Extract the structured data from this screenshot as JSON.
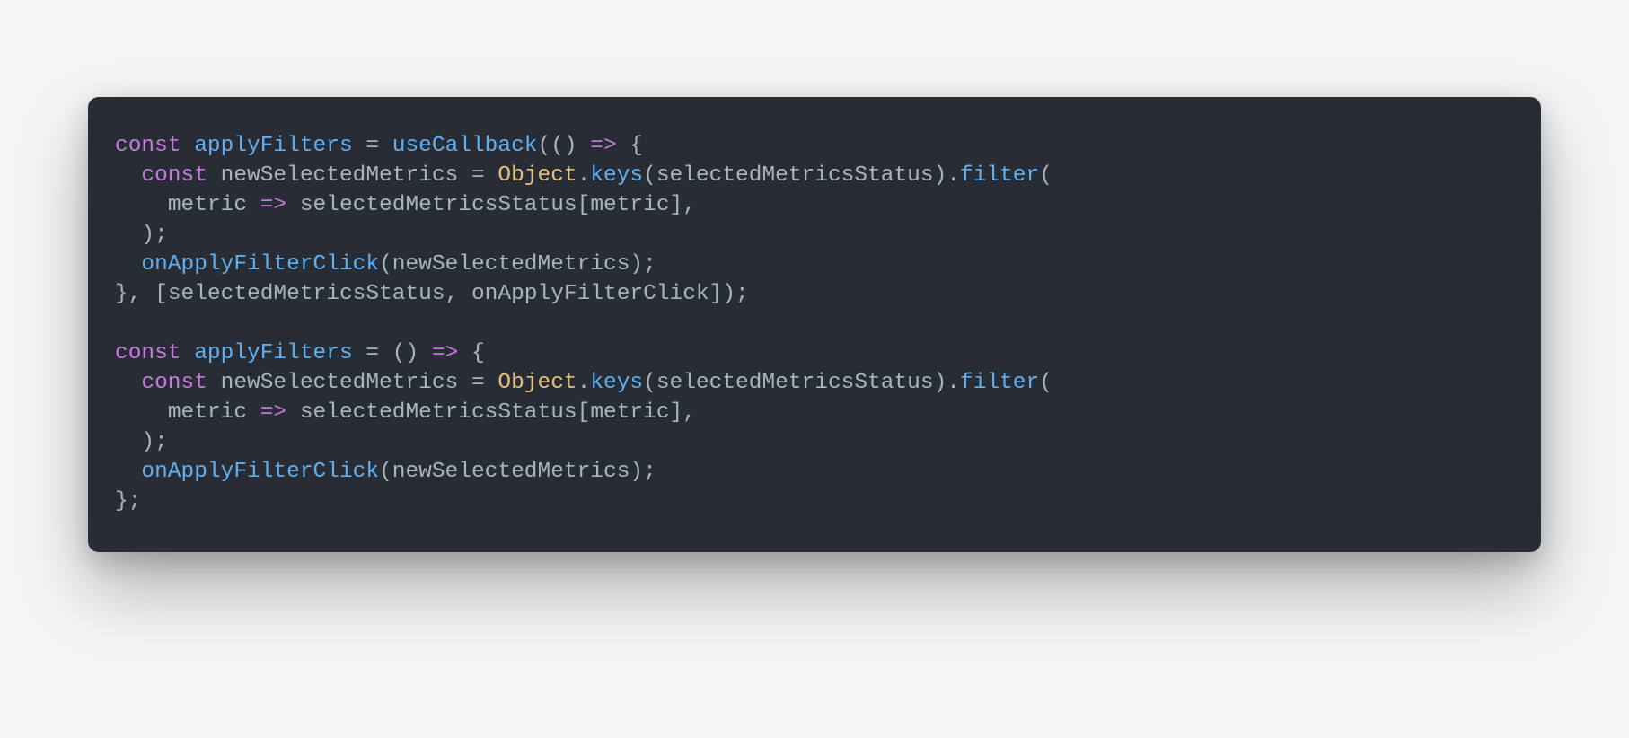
{
  "colors": {
    "bg_page": "#f5f5f5",
    "bg_card": "#282c34",
    "text_default": "#abb2bf",
    "keyword": "#c678dd",
    "function": "#61afef",
    "class": "#e5c07b"
  },
  "code": {
    "lines": [
      [
        {
          "t": "const",
          "c": "kw"
        },
        {
          "t": " ",
          "c": "sp"
        },
        {
          "t": "applyFilters",
          "c": "fn"
        },
        {
          "t": " ",
          "c": "sp"
        },
        {
          "t": "=",
          "c": "op"
        },
        {
          "t": " ",
          "c": "sp"
        },
        {
          "t": "useCallback",
          "c": "fn"
        },
        {
          "t": "(()",
          "c": "punc"
        },
        {
          "t": " ",
          "c": "sp"
        },
        {
          "t": "=>",
          "c": "arrow"
        },
        {
          "t": " ",
          "c": "sp"
        },
        {
          "t": "{",
          "c": "punc"
        }
      ],
      [
        {
          "t": "  ",
          "c": "sp"
        },
        {
          "t": "const",
          "c": "kw"
        },
        {
          "t": " ",
          "c": "sp"
        },
        {
          "t": "newSelectedMetrics",
          "c": "var"
        },
        {
          "t": " ",
          "c": "sp"
        },
        {
          "t": "=",
          "c": "op"
        },
        {
          "t": " ",
          "c": "sp"
        },
        {
          "t": "Object",
          "c": "cls"
        },
        {
          "t": ".",
          "c": "punc"
        },
        {
          "t": "keys",
          "c": "fn"
        },
        {
          "t": "(",
          "c": "punc"
        },
        {
          "t": "selectedMetricsStatus",
          "c": "var"
        },
        {
          "t": ").",
          "c": "punc"
        },
        {
          "t": "filter",
          "c": "fn"
        },
        {
          "t": "(",
          "c": "punc"
        }
      ],
      [
        {
          "t": "    ",
          "c": "sp"
        },
        {
          "t": "metric",
          "c": "var"
        },
        {
          "t": " ",
          "c": "sp"
        },
        {
          "t": "=>",
          "c": "arrow"
        },
        {
          "t": " ",
          "c": "sp"
        },
        {
          "t": "selectedMetricsStatus",
          "c": "var"
        },
        {
          "t": "[",
          "c": "punc"
        },
        {
          "t": "metric",
          "c": "var"
        },
        {
          "t": "],",
          "c": "punc"
        }
      ],
      [
        {
          "t": "  );",
          "c": "punc"
        }
      ],
      [
        {
          "t": "  ",
          "c": "sp"
        },
        {
          "t": "onApplyFilterClick",
          "c": "fn"
        },
        {
          "t": "(",
          "c": "punc"
        },
        {
          "t": "newSelectedMetrics",
          "c": "var"
        },
        {
          "t": ");",
          "c": "punc"
        }
      ],
      [
        {
          "t": "}, [",
          "c": "punc"
        },
        {
          "t": "selectedMetricsStatus",
          "c": "var"
        },
        {
          "t": ", ",
          "c": "punc"
        },
        {
          "t": "onApplyFilterClick",
          "c": "var"
        },
        {
          "t": "]);",
          "c": "punc"
        }
      ],
      [
        {
          "t": "",
          "c": "sp"
        }
      ],
      [
        {
          "t": "const",
          "c": "kw"
        },
        {
          "t": " ",
          "c": "sp"
        },
        {
          "t": "applyFilters",
          "c": "fn"
        },
        {
          "t": " ",
          "c": "sp"
        },
        {
          "t": "=",
          "c": "op"
        },
        {
          "t": " ",
          "c": "sp"
        },
        {
          "t": "()",
          "c": "punc"
        },
        {
          "t": " ",
          "c": "sp"
        },
        {
          "t": "=>",
          "c": "arrow"
        },
        {
          "t": " ",
          "c": "sp"
        },
        {
          "t": "{",
          "c": "punc"
        }
      ],
      [
        {
          "t": "  ",
          "c": "sp"
        },
        {
          "t": "const",
          "c": "kw"
        },
        {
          "t": " ",
          "c": "sp"
        },
        {
          "t": "newSelectedMetrics",
          "c": "var"
        },
        {
          "t": " ",
          "c": "sp"
        },
        {
          "t": "=",
          "c": "op"
        },
        {
          "t": " ",
          "c": "sp"
        },
        {
          "t": "Object",
          "c": "cls"
        },
        {
          "t": ".",
          "c": "punc"
        },
        {
          "t": "keys",
          "c": "fn"
        },
        {
          "t": "(",
          "c": "punc"
        },
        {
          "t": "selectedMetricsStatus",
          "c": "var"
        },
        {
          "t": ").",
          "c": "punc"
        },
        {
          "t": "filter",
          "c": "fn"
        },
        {
          "t": "(",
          "c": "punc"
        }
      ],
      [
        {
          "t": "    ",
          "c": "sp"
        },
        {
          "t": "metric",
          "c": "var"
        },
        {
          "t": " ",
          "c": "sp"
        },
        {
          "t": "=>",
          "c": "arrow"
        },
        {
          "t": " ",
          "c": "sp"
        },
        {
          "t": "selectedMetricsStatus",
          "c": "var"
        },
        {
          "t": "[",
          "c": "punc"
        },
        {
          "t": "metric",
          "c": "var"
        },
        {
          "t": "],",
          "c": "punc"
        }
      ],
      [
        {
          "t": "  );",
          "c": "punc"
        }
      ],
      [
        {
          "t": "  ",
          "c": "sp"
        },
        {
          "t": "onApplyFilterClick",
          "c": "fn"
        },
        {
          "t": "(",
          "c": "punc"
        },
        {
          "t": "newSelectedMetrics",
          "c": "var"
        },
        {
          "t": ");",
          "c": "punc"
        }
      ],
      [
        {
          "t": "};",
          "c": "punc"
        }
      ]
    ]
  }
}
